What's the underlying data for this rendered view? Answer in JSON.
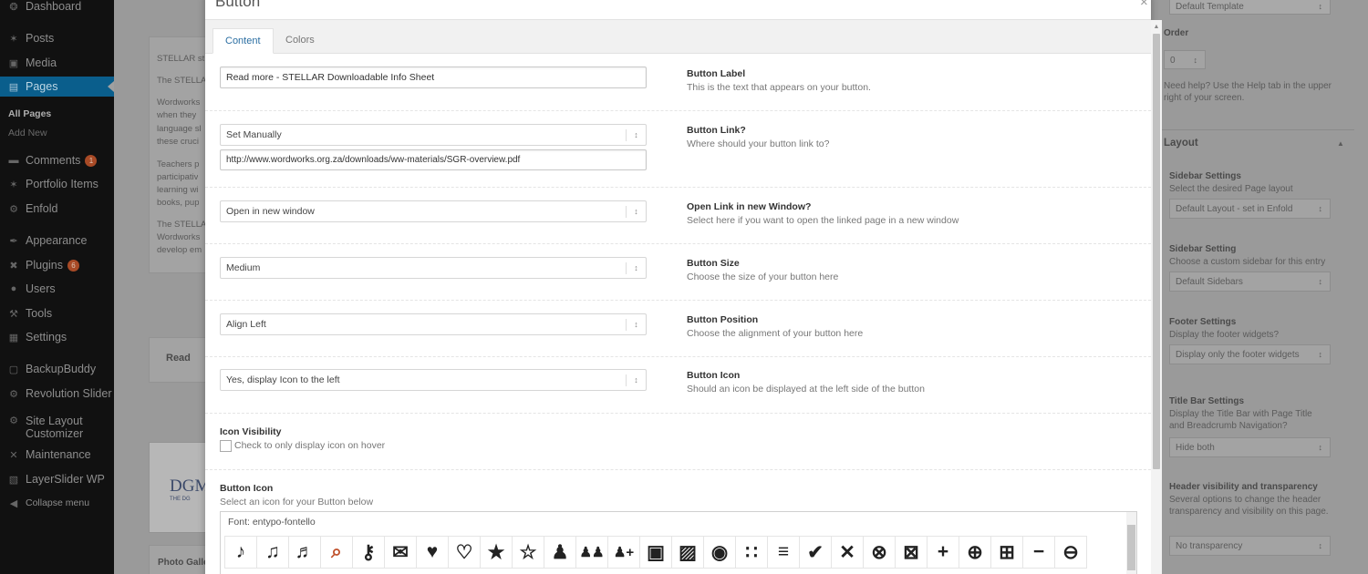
{
  "sidebar": {
    "items": [
      {
        "label": "Dashboard",
        "icon": "dashboard-icon",
        "glyph": "❂"
      },
      {
        "label": "Posts",
        "icon": "pin-icon",
        "glyph": "✶"
      },
      {
        "label": "Media",
        "icon": "media-icon",
        "glyph": "▣"
      },
      {
        "label": "Pages",
        "icon": "pages-icon",
        "glyph": "▤"
      },
      {
        "label": "Comments",
        "icon": "comment-icon",
        "glyph": "▬",
        "badge": "1"
      },
      {
        "label": "Portfolio Items",
        "icon": "pin-icon",
        "glyph": "✶"
      },
      {
        "label": "Enfold",
        "icon": "gear-icon",
        "glyph": "⚙"
      },
      {
        "label": "Appearance",
        "icon": "brush-icon",
        "glyph": "✒"
      },
      {
        "label": "Plugins",
        "icon": "plugin-icon",
        "glyph": "✖",
        "badge": "6"
      },
      {
        "label": "Users",
        "icon": "user-icon",
        "glyph": "●"
      },
      {
        "label": "Tools",
        "icon": "wrench-icon",
        "glyph": "⚒"
      },
      {
        "label": "Settings",
        "icon": "settings-icon",
        "glyph": "▦"
      },
      {
        "label": "BackupBuddy",
        "icon": "backup-icon",
        "glyph": "▢"
      },
      {
        "label": "Revolution Slider",
        "icon": "gear-icon",
        "glyph": "⚙"
      },
      {
        "label": "Site Layout Customizer",
        "icon": "gear-icon",
        "glyph": "⚙"
      },
      {
        "label": "Maintenance",
        "icon": "tools-icon",
        "glyph": "✕"
      },
      {
        "label": "LayerSlider WP",
        "icon": "layers-icon",
        "glyph": "▧"
      },
      {
        "label": "Collapse menu",
        "icon": "collapse-icon",
        "glyph": "◀"
      }
    ],
    "submenu": [
      "All Pages",
      "Add New"
    ]
  },
  "background": {
    "editor_lines": [
      "STELLAR st",
      "The STELLA",
      "Wordworks",
      "when they",
      "language sl",
      "these cruci",
      "Teachers p",
      "participativ",
      "learning wi",
      "books, pup",
      "The STELLA",
      "Wordworks",
      "develop em"
    ],
    "read_text": "Read",
    "logo_text": "DGM",
    "logo_sub": "THE DG",
    "photo_gallery": "Photo Galle"
  },
  "right_panel": {
    "template_value": "Default Template",
    "order_label": "Order",
    "order_value": "0",
    "help_text": "Need help? Use the Help tab in the upper right of your screen.",
    "layout_title": "Layout",
    "sidebar_settings_title": "Sidebar Settings",
    "sidebar_settings_desc": "Select the desired Page layout",
    "sidebar_settings_value": "Default Layout - set in Enfold",
    "sidebar_setting_title": "Sidebar Setting",
    "sidebar_setting_desc": "Choose a custom sidebar for this entry",
    "sidebar_setting_value": "Default Sidebars",
    "footer_title": "Footer Settings",
    "footer_desc": "Display the footer widgets?",
    "footer_value": "Display only the footer widgets",
    "titlebar_title": "Title Bar Settings",
    "titlebar_desc": "Display the Title Bar with Page Title and Breadcrumb Navigation?",
    "titlebar_value": "Hide both",
    "header_title": "Header visibility and transparency",
    "header_desc": "Several options to change the header transparency and visibility on this page.",
    "header_value": "No transparency"
  },
  "modal": {
    "title": "Button",
    "close": "×",
    "tabs": [
      "Content",
      "Colors"
    ],
    "label_value": "Read more - STELLAR Downloadable Info Sheet",
    "label_title": "Button Label",
    "label_desc": "This is the text that appears on your button.",
    "link_select": "Set Manually",
    "link_url": "http://www.wordworks.org.za/downloads/ww-materials/SGR-overview.pdf",
    "link_title": "Button Link?",
    "link_desc": "Where should your button link to?",
    "window_select": "Open in new window",
    "window_title": "Open Link in new Window?",
    "window_desc": "Select here if you want to open the linked page in a new window",
    "size_select": "Medium",
    "size_title": "Button Size",
    "size_desc": "Choose the size of your button here",
    "position_select": "Align Left",
    "position_title": "Button Position",
    "position_desc": "Choose the alignment of your button here",
    "icon_select": "Yes, display Icon to the left",
    "icon_title": "Button Icon",
    "icon_desc": "Should an icon be displayed at the left side of the button",
    "visibility_title": "Icon Visibility",
    "visibility_check": "Check to only display icon on hover",
    "picker_title": "Button Icon",
    "picker_desc": "Select an icon for your Button below",
    "font_label": "Font: entypo-fontello",
    "select_arrow": "↕",
    "icons": [
      {
        "name": "note-icon",
        "glyph": "♪"
      },
      {
        "name": "music-icon",
        "glyph": "♫"
      },
      {
        "name": "music-box-icon",
        "glyph": "♬"
      },
      {
        "name": "search-icon",
        "glyph": "⌕"
      },
      {
        "name": "key-icon",
        "glyph": "⚷"
      },
      {
        "name": "mail-icon",
        "glyph": "✉"
      },
      {
        "name": "heart-icon",
        "glyph": "♥"
      },
      {
        "name": "heart-empty-icon",
        "glyph": "♡"
      },
      {
        "name": "star-icon",
        "glyph": "★"
      },
      {
        "name": "star-empty-icon",
        "glyph": "☆"
      },
      {
        "name": "user-icon",
        "glyph": "♟"
      },
      {
        "name": "users-icon",
        "glyph": "♟♟"
      },
      {
        "name": "user-add-icon",
        "glyph": "♟+"
      },
      {
        "name": "video-icon",
        "glyph": "▣"
      },
      {
        "name": "picture-icon",
        "glyph": "▨"
      },
      {
        "name": "camera-icon",
        "glyph": "◉"
      },
      {
        "name": "layout-icon",
        "glyph": "∷"
      },
      {
        "name": "menu-icon",
        "glyph": "≡"
      },
      {
        "name": "check-icon",
        "glyph": "✔"
      },
      {
        "name": "cancel-icon",
        "glyph": "✕"
      },
      {
        "name": "cancel-circled-icon",
        "glyph": "⊗"
      },
      {
        "name": "cancel-squared-icon",
        "glyph": "⊠"
      },
      {
        "name": "plus-icon",
        "glyph": "+"
      },
      {
        "name": "plus-circled-icon",
        "glyph": "⊕"
      },
      {
        "name": "plus-squared-icon",
        "glyph": "⊞"
      },
      {
        "name": "minus-icon",
        "glyph": "−"
      },
      {
        "name": "minus-circled-icon",
        "glyph": "⊖"
      }
    ]
  },
  "colors": {
    "accent": "#0a5e8c",
    "selected_icon": "#c0522d"
  }
}
